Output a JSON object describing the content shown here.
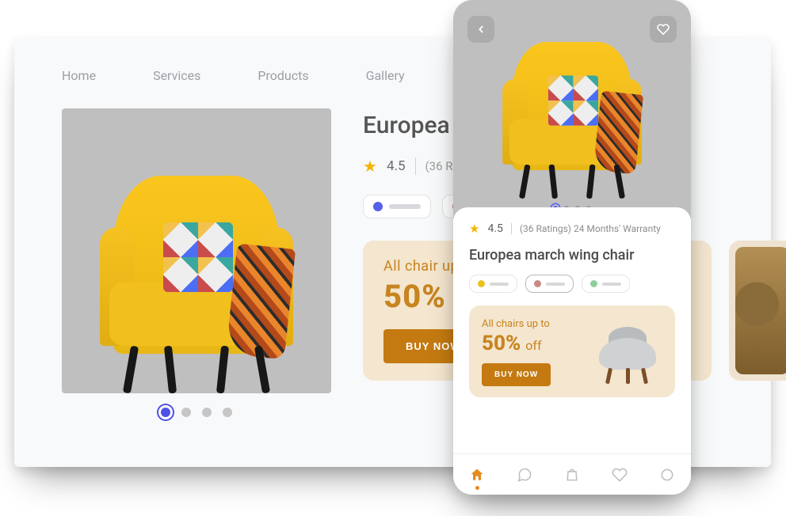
{
  "nav": [
    "Home",
    "Services",
    "Products",
    "Gallery"
  ],
  "product": {
    "title": "Europea march wing chair",
    "title_short": "Europea ma",
    "rating": "4.5",
    "ratings_count_label": "(36 Ratings)",
    "ratings_full_label": "(36 Ratings) 24 Months' Warranty",
    "colors": {
      "blue": "#5561e6",
      "yellow": "#e9c21f",
      "rose": "#c98a84",
      "green": "#8fcf9b"
    }
  },
  "promo": {
    "line1_desktop": "All chair up to",
    "line1_mobile": "All chairs up to",
    "percent": "50%",
    "off": "off",
    "buy_label": "BUY NOW"
  },
  "carousel": {
    "count": 4,
    "active_index": 0
  },
  "tabbar": [
    "home",
    "chat",
    "bag",
    "heart",
    "profile"
  ]
}
